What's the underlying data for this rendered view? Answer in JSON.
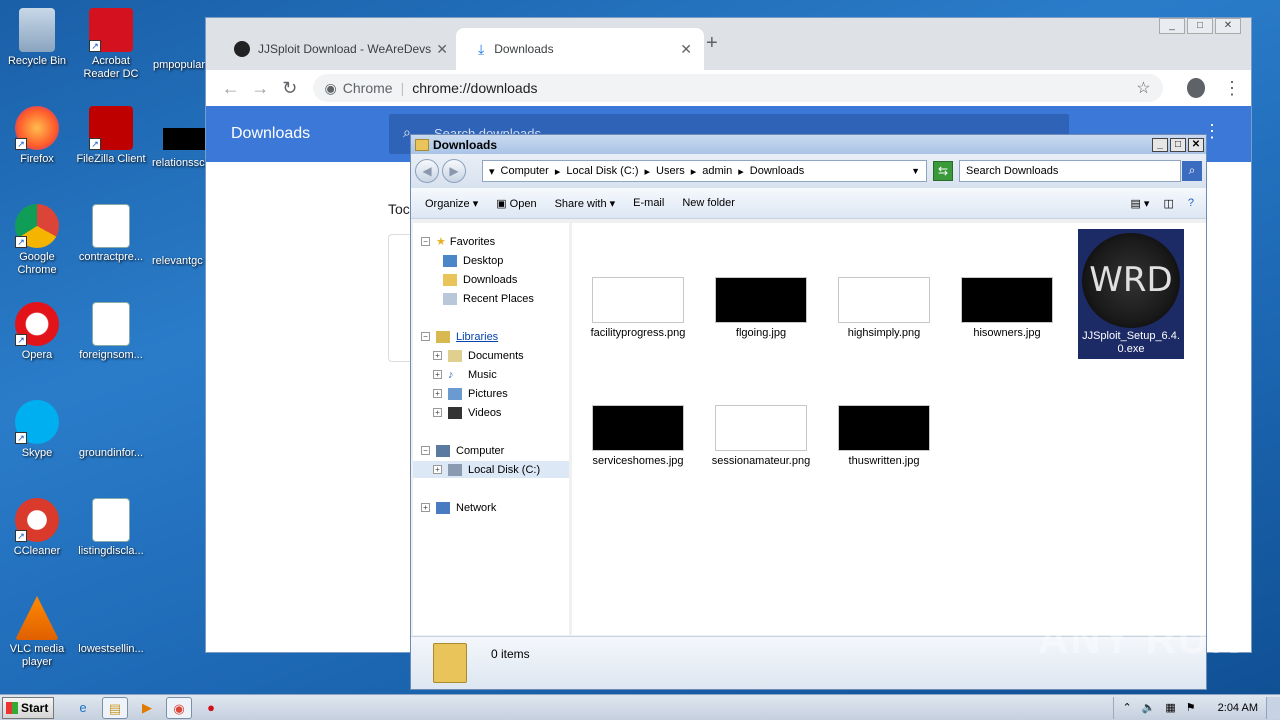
{
  "desktop": {
    "icons": [
      {
        "label": "Recycle Bin"
      },
      {
        "label": "Acrobat Reader DC"
      },
      {
        "label": "Firefox"
      },
      {
        "label": "FileZilla Client"
      },
      {
        "label": "Google Chrome"
      },
      {
        "label": "contractpre..."
      },
      {
        "label": "Opera"
      },
      {
        "label": "foreignsom..."
      },
      {
        "label": "Skype"
      },
      {
        "label": "groundinfor..."
      },
      {
        "label": "CCleaner"
      },
      {
        "label": "listingdiscla..."
      },
      {
        "label": "VLC media player"
      },
      {
        "label": "lowestsellin..."
      }
    ],
    "partial_labels": [
      "pmpopular",
      "relationssc",
      "relevantgc"
    ]
  },
  "chrome": {
    "tabs": [
      {
        "title": "JJSploit Download - WeAreDevs",
        "active": false
      },
      {
        "title": "Downloads",
        "active": true
      }
    ],
    "omnibox": {
      "scheme_label": "Chrome",
      "url": "chrome://downloads"
    },
    "downloads_page": {
      "title": "Downloads",
      "search_placeholder": "Search downloads",
      "partial_text": "Toc"
    }
  },
  "explorer": {
    "title": "Downloads",
    "breadcrumbs": [
      "Computer",
      "Local Disk (C:)",
      "Users",
      "admin",
      "Downloads"
    ],
    "search_placeholder": "Search Downloads",
    "commands": [
      "Organize",
      "Open",
      "Share with",
      "E-mail",
      "New folder"
    ],
    "nav": {
      "favorites": {
        "label": "Favorites",
        "items": [
          "Desktop",
          "Downloads",
          "Recent Places"
        ]
      },
      "libraries": {
        "label": "Libraries",
        "items": [
          "Documents",
          "Music",
          "Pictures",
          "Videos"
        ]
      },
      "computer": {
        "label": "Computer",
        "items": [
          "Local Disk (C:)"
        ]
      },
      "network": {
        "label": "Network"
      }
    },
    "files": [
      {
        "name": "facilityprogress.png",
        "thumb_color": "#ffffff"
      },
      {
        "name": "flgoing.jpg",
        "thumb_color": "#000000"
      },
      {
        "name": "highsimply.png",
        "thumb_color": "#ffffff"
      },
      {
        "name": "hisowners.jpg",
        "thumb_color": "#000000"
      },
      {
        "name": "JJSploit_Setup_6.4.0.exe",
        "icon_text": "WRD"
      },
      {
        "name": "serviceshomes.jpg",
        "thumb_color": "#000000"
      },
      {
        "name": "sessionamateur.png",
        "thumb_color": "#ffffff"
      },
      {
        "name": "thuswritten.jpg",
        "thumb_color": "#000000"
      }
    ],
    "status": {
      "count": "0 items"
    }
  },
  "watermark": "ANY RUN",
  "taskbar": {
    "start_label": "Start",
    "clock": "2:04 AM"
  },
  "colors": {
    "chrome_accent": "#3c78d8",
    "desktop_bg": "#1f6bb8"
  }
}
